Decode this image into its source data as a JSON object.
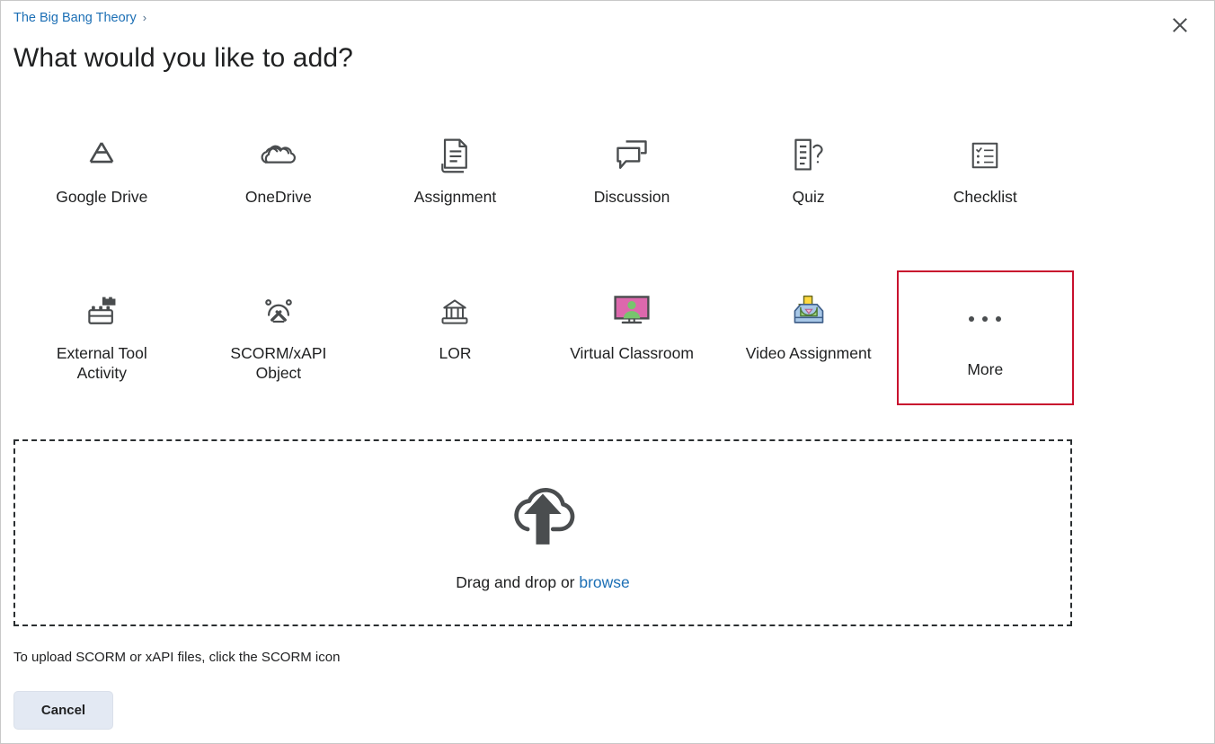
{
  "dialog": {
    "breadcrumb": {
      "label": "The Big Bang Theory",
      "separator": "›"
    },
    "close_label": "✕",
    "title": "What would you like to add?"
  },
  "grid": {
    "row1": [
      {
        "label": "Google Drive",
        "icon": "google-drive-icon"
      },
      {
        "label": "OneDrive",
        "icon": "onedrive-cloud-icon"
      },
      {
        "label": "Assignment",
        "icon": "assignment-document-icon"
      },
      {
        "label": "Discussion",
        "icon": "discussion-speech-bubbles-icon"
      },
      {
        "label": "Quiz",
        "icon": "quiz-question-document-icon"
      },
      {
        "label": "Checklist",
        "icon": "checklist-icon"
      }
    ],
    "row2": [
      {
        "label": "External Tool Activity",
        "icon": "lego-brick-icon"
      },
      {
        "label": "SCORM/xAPI Object",
        "icon": "scorm-object-icon"
      },
      {
        "label": "LOR",
        "icon": "bank-building-icon"
      },
      {
        "label": "Virtual Classroom",
        "icon": "monitor-person-icon"
      },
      {
        "label": "Video Assignment",
        "icon": "inbox-download-icon"
      },
      {
        "label": "More",
        "icon": "ellipsis-icon",
        "focused": true
      }
    ]
  },
  "dropzone": {
    "icon": "cloud-upload-icon",
    "text_prefix": "Drag and drop or ",
    "browse_label": "browse"
  },
  "footer": {
    "hint": "To upload SCORM or xAPI files, click the SCORM icon",
    "cancel_label": "Cancel"
  },
  "colors": {
    "link": "#1c6fb5",
    "focus_outline": "#c8102e",
    "icon_dark": "#494c4e",
    "monitor_pink": "#dd68ad",
    "person_green": "#78c46e",
    "tray_blue": "#a8c8e8",
    "arrow_yellow": "#ffd940",
    "cancel_bg": "#e3e9f3"
  }
}
